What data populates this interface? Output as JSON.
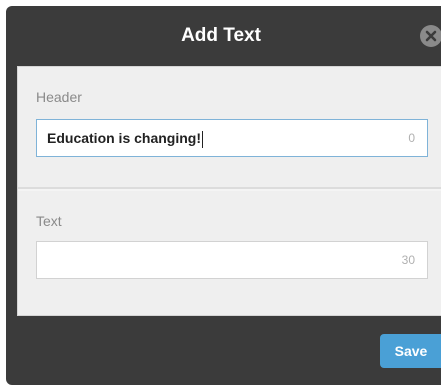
{
  "dialog": {
    "title": "Add Text",
    "close_icon": "close-icon"
  },
  "header_field": {
    "label": "Header",
    "value": "Education is changing!",
    "counter": "0"
  },
  "text_field": {
    "label": "Text",
    "value": "",
    "counter": "30"
  },
  "footer": {
    "save_label": "Save"
  },
  "colors": {
    "dialog_bg": "#3b3b3b",
    "panel_bg": "#efefef",
    "accent": "#4aa0d6",
    "focus_border": "#7fb3d8"
  }
}
